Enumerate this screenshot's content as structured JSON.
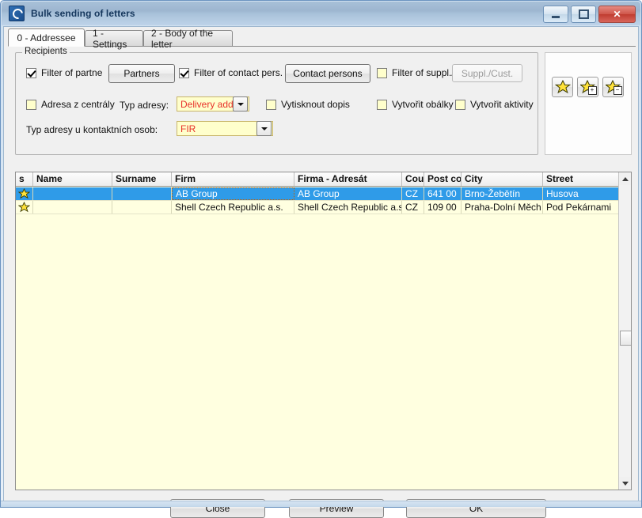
{
  "window": {
    "title": "Bulk sending of letters",
    "icon": "app-icon",
    "controls": {
      "minimize": "minimize-icon",
      "maximize": "maximize-icon",
      "close": "✕"
    }
  },
  "tabs": [
    {
      "label": "0 - Addressee",
      "active": true
    },
    {
      "label": "1 - Settings",
      "active": false
    },
    {
      "label": "2 - Body of the letter",
      "active": false
    }
  ],
  "recipients": {
    "group_title": "Recipients",
    "filter_of_partners": {
      "label": "Filter of partne",
      "checked": true
    },
    "partners_button": "Partners",
    "filter_of_contact_persons": {
      "label": "Filter of contact pers.",
      "checked": true
    },
    "contact_persons_button": "Contact persons",
    "filter_of_suppliers": {
      "label": "Filter of suppl./",
      "checked": false
    },
    "suppl_cust_button": {
      "label": "Suppl./Cust.",
      "disabled": true
    },
    "address_from_hq": {
      "label": "Adresa z centrály",
      "checked": false
    },
    "address_type_label": "Typ adresy:",
    "address_type_value": "Delivery addr",
    "print_letter": {
      "label": "Vytisknout dopis",
      "checked": false
    },
    "create_envelopes": {
      "label": "Vytvořit obálky",
      "checked": false
    },
    "create_activities": {
      "label": "Vytvořit aktivity",
      "checked": false
    },
    "contact_address_type_label": "Typ adresy u kontaktních osob:",
    "contact_address_type_value": "FIR"
  },
  "star_buttons": [
    {
      "name": "star-icon",
      "badge": ""
    },
    {
      "name": "star-plus-icon",
      "badge": "+"
    },
    {
      "name": "star-minus-icon",
      "badge": "−"
    }
  ],
  "grid": {
    "columns": [
      {
        "label": "s",
        "width": 22
      },
      {
        "label": "Name",
        "width": 100
      },
      {
        "label": "Surname",
        "width": 75
      },
      {
        "label": "Firm",
        "width": 155
      },
      {
        "label": "Firma - Adresát",
        "width": 136
      },
      {
        "label": "Cour",
        "width": 28
      },
      {
        "label": "Post co",
        "width": 47
      },
      {
        "label": "City",
        "width": 103
      },
      {
        "label": "Street",
        "width": 95
      }
    ],
    "rows": [
      {
        "selected": true,
        "star": "star-icon",
        "name": "",
        "surname": "",
        "firm": "AB Group",
        "firm_addressee": "AB Group",
        "country": "CZ",
        "postcode": "641 00",
        "city": "Brno-Žebětín",
        "street": "Husova"
      },
      {
        "selected": false,
        "star": "star-icon",
        "name": "",
        "surname": "",
        "firm": "Shell Czech Republic a.s.",
        "firm_addressee": "Shell Czech Republic a.s.",
        "country": "CZ",
        "postcode": "109 00",
        "city": "Praha-Dolní Měch…",
        "street": "Pod Pekárnami"
      }
    ],
    "scrollbar": {
      "up": "scroll-up-icon",
      "down": "scroll-down-icon"
    }
  },
  "footer": {
    "close": "Close",
    "preview": "Preview",
    "ok": "OK"
  },
  "colors": {
    "selection": "#2f9be8",
    "field_background": "#ffffcc",
    "field_text": "#e8312a",
    "grid_background": "#ffffe0"
  }
}
